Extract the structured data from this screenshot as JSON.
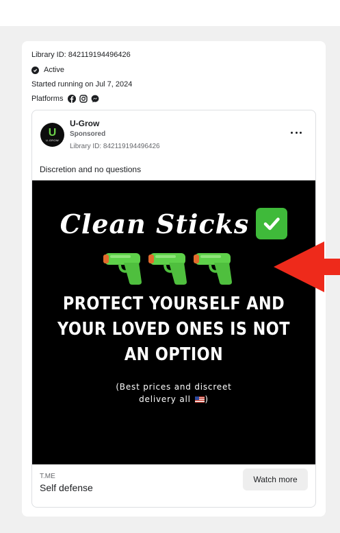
{
  "library": {
    "id_text": "Library ID: 842119194496426",
    "status": "Active",
    "started": "Started running on Jul 7, 2024",
    "platforms_label": "Platforms",
    "platform_icons": [
      "facebook-icon",
      "instagram-icon",
      "messenger-icon"
    ]
  },
  "ad": {
    "advertiser": "U-Grow",
    "logo_letter": "U",
    "logo_subtext": "U-GROW",
    "sponsored": "Sponsored",
    "library_id": "Library ID: 842119194496426",
    "body": "Discretion and no questions",
    "creative": {
      "headline": "Clean Sticks",
      "main_line1": "PROTECT YOURSELF AND",
      "main_line2": "YOUR LOVED ONES IS NOT",
      "main_line3": "AN OPTION",
      "sub_line1": "(Best prices and discreet",
      "sub_line2": "delivery all",
      "sub_line2_end": ")"
    },
    "cta": {
      "domain": "T.ME",
      "title": "Self defense",
      "button": "Watch more"
    }
  },
  "colors": {
    "accent_green": "#3fba3a",
    "gun_green": "#5ed14a",
    "arrow_red": "#ee2a1b"
  }
}
